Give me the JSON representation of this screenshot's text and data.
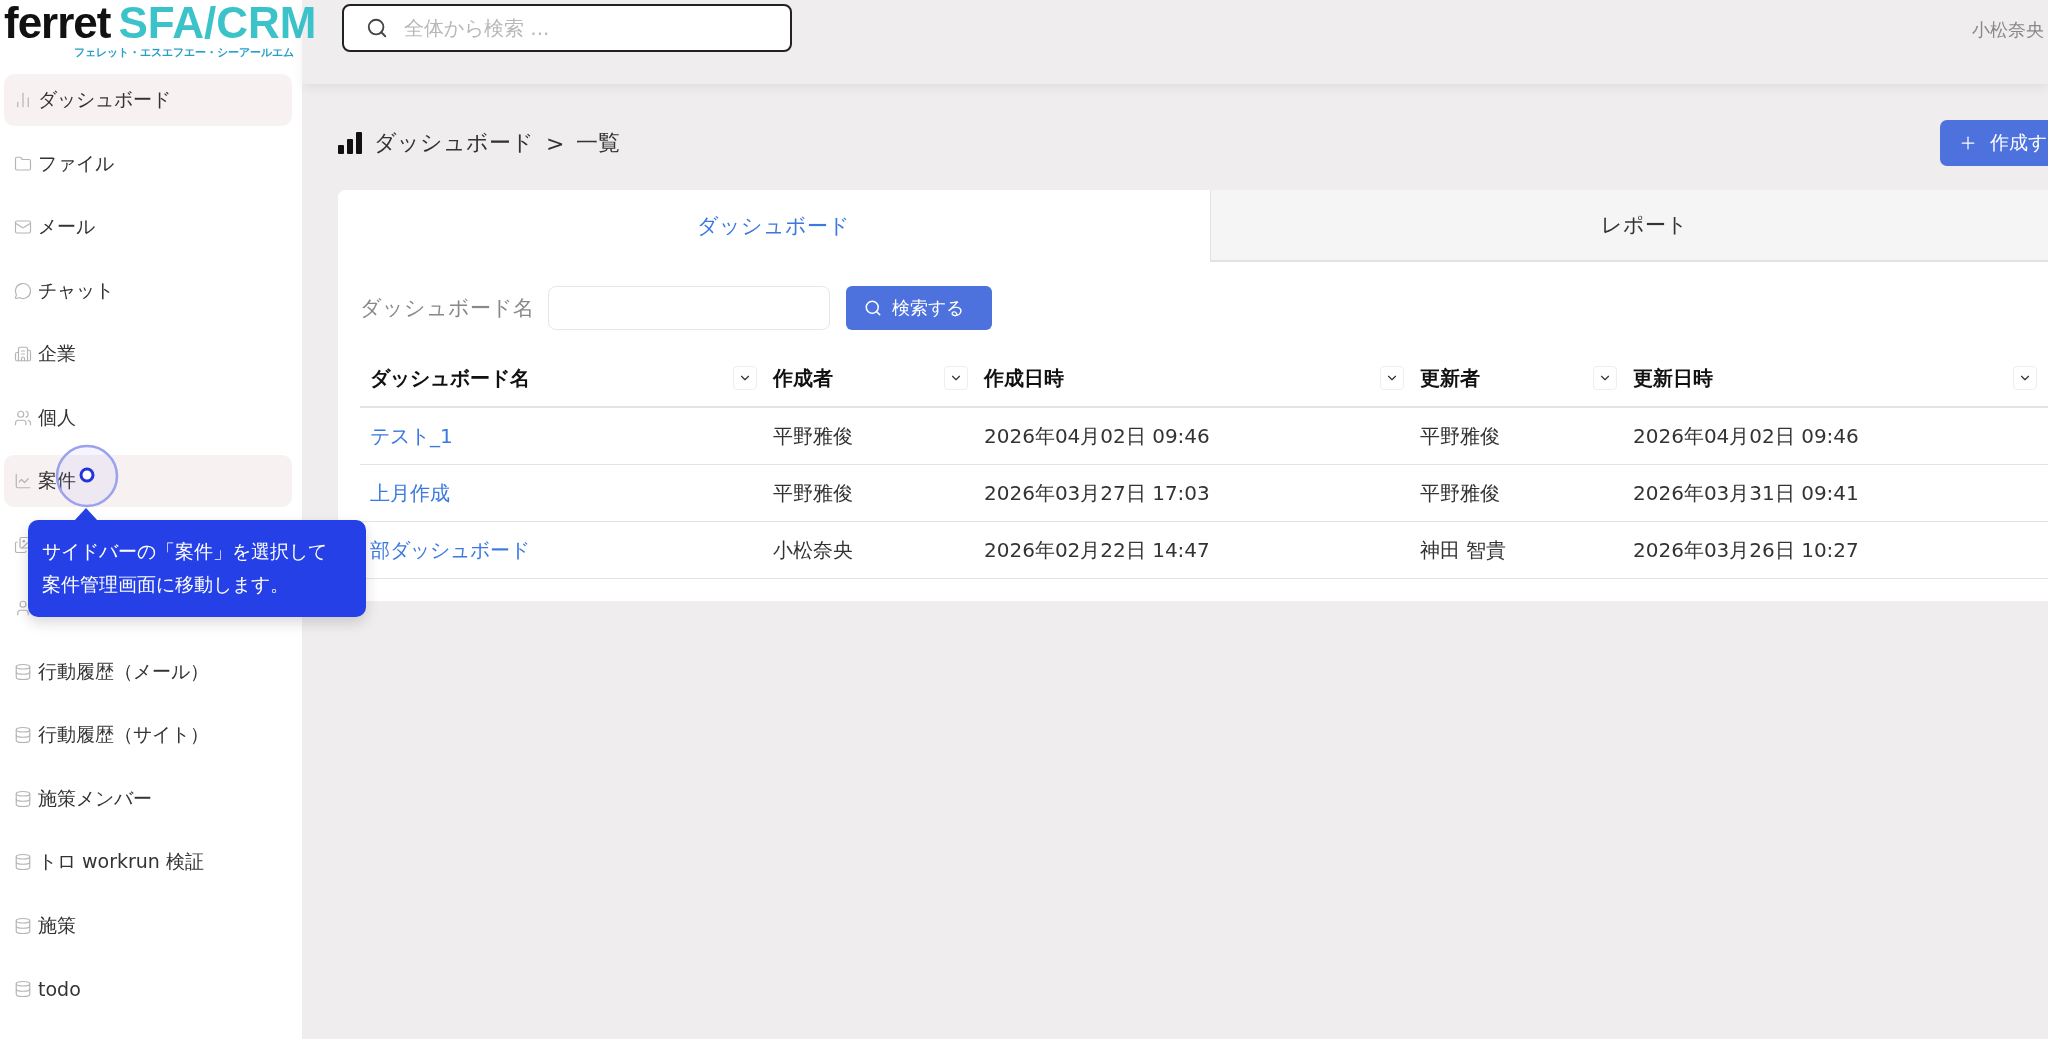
{
  "logo": {
    "brand": "ferret",
    "product": "SFA/CRM",
    "reading": "フェレット・エスエフエー・シーアールエム"
  },
  "sidebar": {
    "items": [
      {
        "label": "ダッシュボード",
        "selected": true
      },
      {
        "label": "ファイル",
        "selected": false
      },
      {
        "label": "メール",
        "selected": false
      },
      {
        "label": "チャット",
        "selected": false
      },
      {
        "label": "企業",
        "selected": false
      },
      {
        "label": "個人",
        "selected": false
      },
      {
        "label": "案件",
        "selected": true
      },
      {
        "selected": false
      },
      {
        "selected": false
      },
      {
        "label": "行動履歴（メール）",
        "selected": false
      },
      {
        "label": "行動履歴（サイト）",
        "selected": false
      },
      {
        "label": "施策メンバー",
        "selected": false
      },
      {
        "label": "トロ workrun 検証",
        "selected": false
      },
      {
        "label": "施策",
        "selected": false
      },
      {
        "label": "todo",
        "selected": false
      }
    ]
  },
  "search": {
    "placeholder": "全体から検索 ..."
  },
  "user": "小松奈央",
  "breadcrumb": {
    "section": "ダッシュボード",
    "separator": ">",
    "page": "一覧"
  },
  "create_button": "作成す",
  "tabs": [
    {
      "label": "ダッシュボード",
      "selected": true
    },
    {
      "label": "レポート",
      "selected": false
    }
  ],
  "filter": {
    "label": "ダッシュボード名",
    "button": "検索する"
  },
  "table": {
    "columns": [
      "ダッシュボード名",
      "作成者",
      "作成日時",
      "更新者",
      "更新日時"
    ],
    "rows": [
      [
        "テスト_1",
        "平野雅俊",
        "2026年04月02日 09:46",
        "平野雅俊",
        "2026年04月02日 09:46"
      ],
      [
        "上月作成",
        "平野雅俊",
        "2026年03月27日 17:03",
        "平野雅俊",
        "2026年03月31日 09:41"
      ],
      [
        "部ダッシュボード",
        "小松奈央",
        "2026年02月22日 14:47",
        "神田 智貴",
        "2026年03月26日 10:27"
      ]
    ]
  },
  "tooltip": [
    "サイドバーの「案件」を選択して",
    "案件管理画面に移動します。"
  ]
}
